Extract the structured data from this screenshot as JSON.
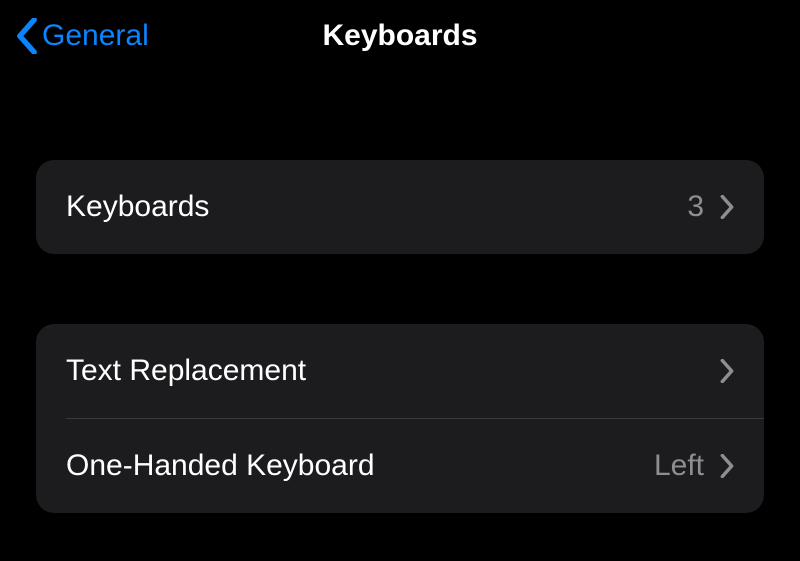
{
  "nav": {
    "back_label": "General",
    "title": "Keyboards"
  },
  "group1": {
    "keyboards_label": "Keyboards",
    "keyboards_count": "3"
  },
  "group2": {
    "text_replacement_label": "Text Replacement",
    "one_handed_label": "One-Handed Keyboard",
    "one_handed_value": "Left"
  }
}
